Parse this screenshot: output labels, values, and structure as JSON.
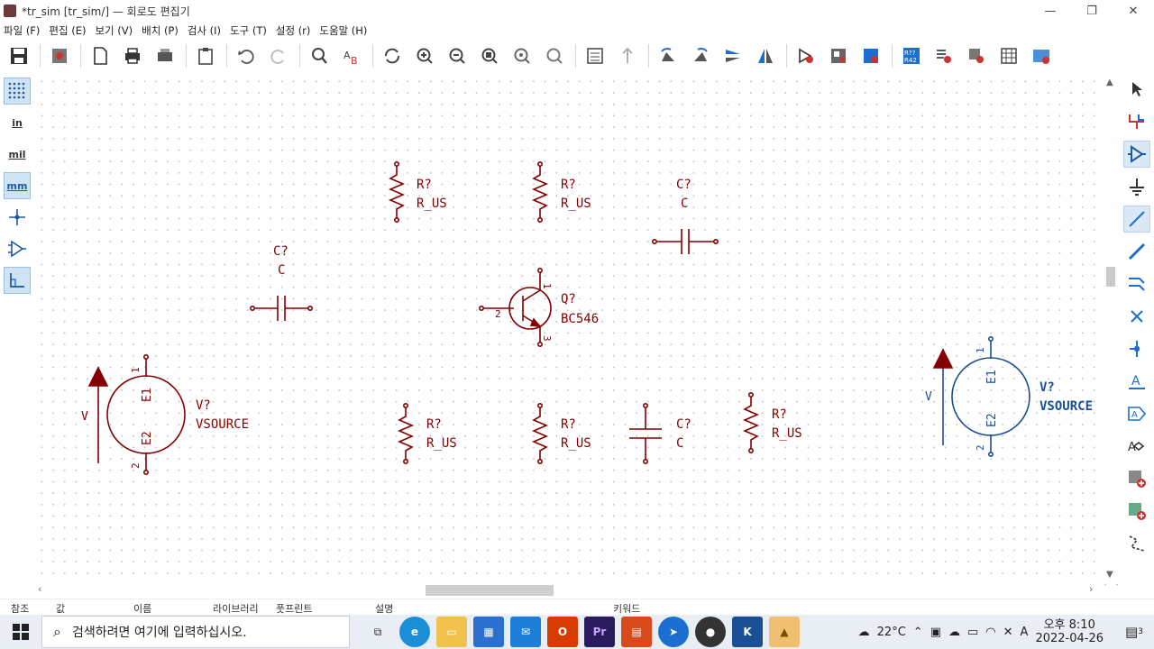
{
  "window": {
    "title": "*tr_sim [tr_sim/] — 회로도 편집기",
    "minimize": "—",
    "maximize": "❐",
    "close": "✕"
  },
  "menu": [
    "파일 (F)",
    "편집 (E)",
    "보기 (V)",
    "배치 (P)",
    "검사 (I)",
    "도구 (T)",
    "설정 (r)",
    "도움말 (H)"
  ],
  "left_tools": [
    {
      "name": "grid-toggle",
      "label": "",
      "active": true
    },
    {
      "name": "units-inches",
      "label": "in",
      "active": false
    },
    {
      "name": "units-mils",
      "label": "mil",
      "active": false
    },
    {
      "name": "units-mm",
      "label": "mm",
      "active": true
    },
    {
      "name": "cursor-crosshair",
      "label": "",
      "active": false
    },
    {
      "name": "hidden-pins",
      "label": "",
      "active": false
    },
    {
      "name": "wire-45-mode",
      "label": "",
      "active": true
    }
  ],
  "schematic": {
    "resistors": [
      {
        "ref": "R?",
        "value": "R_US"
      },
      {
        "ref": "R?",
        "value": "R_US"
      },
      {
        "ref": "R?",
        "value": "R_US"
      },
      {
        "ref": "R?",
        "value": "R_US"
      },
      {
        "ref": "R?",
        "value": "R_US"
      }
    ],
    "capacitors": [
      {
        "ref": "C?",
        "value": "C"
      },
      {
        "ref": "C?",
        "value": "C"
      },
      {
        "ref": "C?",
        "value": "C"
      }
    ],
    "transistor": {
      "ref": "Q?",
      "value": "BC546",
      "pin_b": "2",
      "pin_c": "1",
      "pin_e": "3"
    },
    "sources": [
      {
        "ref": "V?",
        "value": "VSOURCE",
        "side_label": "V",
        "pin1": "1",
        "pin2": "2",
        "e1": "E1",
        "e2": "E2"
      },
      {
        "ref": "V?",
        "value": "VSOURCE",
        "side_label": "V",
        "pin1": "1",
        "pin2": "2",
        "e1": "E1",
        "e2": "E2"
      }
    ]
  },
  "status_headers": {
    "ref": "참조",
    "value": "값",
    "name": "이름",
    "library": "라이브러리",
    "footprint": "풋프린트",
    "description": "설명",
    "keywords": "키워드"
  },
  "taskbar": {
    "search_placeholder": "검색하려면 여기에 입력하십시오.",
    "weather": "22°C",
    "ime": "A",
    "time": "오후 8:10",
    "date": "2022-04-26",
    "notification_count": "3"
  },
  "colors": {
    "symbol": "#840000",
    "selected": "#1a5aa0",
    "accent": "#1a6fd0"
  }
}
